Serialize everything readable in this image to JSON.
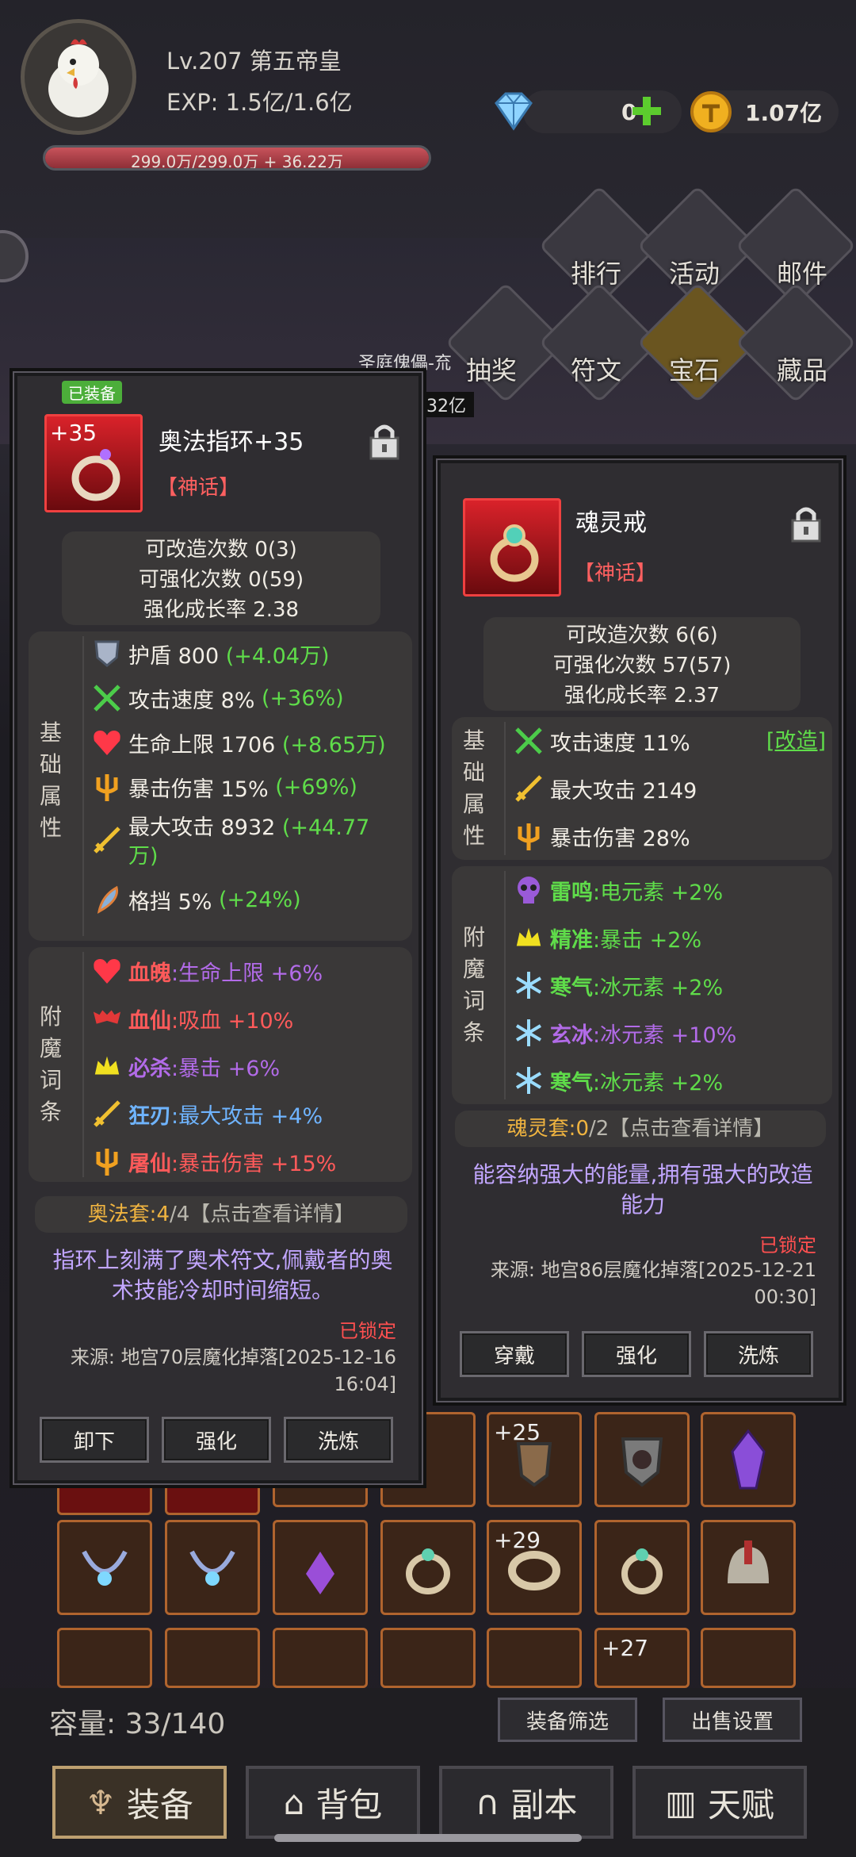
{
  "header": {
    "level": "Lv.207 第五帝皇",
    "exp": "EXP: 1.5亿/1.6亿",
    "hp_text": "299.0万/299.0万 + 36.22万",
    "hp_fill": 1.0,
    "gems": "0",
    "gold": "1.07亿"
  },
  "nav": {
    "rank": "排行",
    "event": "活动",
    "mail": "邮件",
    "lottery": "抽奖",
    "rune": "符文",
    "gem": "宝石",
    "collection": "藏品"
  },
  "bg_texts": {
    "boss": "圣庭傀儡-㐬",
    "amount": "32亿"
  },
  "left": {
    "equipped_badge": "已装备",
    "plus": "+35",
    "name": "奥法指环+35",
    "rarity": "【神话】",
    "stats_top": [
      "可改造次数 0(3)",
      "可强化次数 0(59)",
      "强化成长率 2.38"
    ],
    "base_label": "基础属性",
    "base": [
      {
        "icon": "shield-icon",
        "label": "护盾 800",
        "bonus": "(+4.04万)"
      },
      {
        "icon": "crossed-arrows-icon",
        "label": "攻击速度 8%",
        "bonus": "(+36%)"
      },
      {
        "icon": "heart-icon",
        "label": "生命上限 1706",
        "bonus": "(+8.65万)"
      },
      {
        "icon": "trident-icon",
        "label": "暴击伤害 15%",
        "bonus": "(+69%)"
      },
      {
        "icon": "sword-icon",
        "label": "最大攻击 8932",
        "bonus": "(+44.77",
        "bonus2": "万)"
      },
      {
        "icon": "blade-icon",
        "label": "格挡 5%",
        "bonus": "(+24%)"
      }
    ],
    "ench_label": "附魔词条",
    "ench": [
      {
        "icon": "heart-icon",
        "name": "血魄",
        "desc": ":生命上限 +6%",
        "color": "#ff5a5a",
        "desc_color": "#b26be8"
      },
      {
        "icon": "bat-icon",
        "name": "血仙",
        "desc": ":吸血 +10%",
        "color": "#ff5a5a",
        "desc_color": "#ff5a5a"
      },
      {
        "icon": "crown-icon",
        "name": "必杀",
        "desc": ":暴击 +6%",
        "color": "#b26be8",
        "desc_color": "#b26be8"
      },
      {
        "icon": "sword-icon",
        "name": "狂刃",
        "desc": ":最大攻击 +4%",
        "color": "#6fb4ff",
        "desc_color": "#6fb4ff"
      },
      {
        "icon": "trident-icon",
        "name": "屠仙",
        "desc": ":暴击伤害 +15%",
        "color": "#ff5a5a",
        "desc_color": "#ff5a5a"
      }
    ],
    "set": "奥法套:",
    "set_count": "4",
    "set_total": "/4",
    "set_hint": "【点击查看详情】",
    "desc": "指环上刻满了奥术符文,佩戴者的奥术技能冷却时间缩短。",
    "locked": "已锁定",
    "source1": "来源: 地宫70层魔化掉落[2025-12-16",
    "source2": "16:04]",
    "btns": [
      "卸下",
      "强化",
      "洗炼"
    ]
  },
  "right": {
    "name": "魂灵戒",
    "rarity": "【神话】",
    "stats_top": [
      "可改造次数 6(6)",
      "可强化次数 57(57)",
      "强化成长率 2.37"
    ],
    "base_label": "基础属性",
    "modify": "[改造]",
    "base": [
      {
        "icon": "crossed-arrows-icon",
        "label": "攻击速度 11%"
      },
      {
        "icon": "sword-icon",
        "label": "最大攻击 2149"
      },
      {
        "icon": "trident-icon",
        "label": "暴击伤害 28%"
      }
    ],
    "ench_label": "附魔词条",
    "ench": [
      {
        "icon": "skull-icon",
        "name": "雷鸣",
        "desc": ":电元素 +2%"
      },
      {
        "icon": "crown-icon",
        "name": "精准",
        "desc": ":暴击 +2%"
      },
      {
        "icon": "snowflake-icon",
        "name": "寒气",
        "desc": ":冰元素 +2%"
      },
      {
        "icon": "snowflake-icon",
        "name": "玄冰",
        "desc": ":冰元素 +10%"
      },
      {
        "icon": "snowflake-icon",
        "name": "寒气",
        "desc": ":冰元素 +2%"
      }
    ],
    "set": "魂灵套:",
    "set_count": "0",
    "set_total": "/2",
    "set_hint": "【点击查看详情】",
    "desc": "能容纳强大的能量,拥有强大的改造能力",
    "locked": "已锁定",
    "source1": "来源: 地宫86层魔化掉落[2025-12-21",
    "source2": "00:30]",
    "btns": [
      "穿戴",
      "强化",
      "洗炼"
    ]
  },
  "grid_labels": {
    "a": "+25",
    "b": "+29",
    "c": "+27"
  },
  "bottom": {
    "capacity": "容量: 33/140",
    "filter": "装备筛选",
    "sell": "出售设置",
    "tabs": [
      "装备",
      "背包",
      "副本",
      "天赋"
    ]
  }
}
